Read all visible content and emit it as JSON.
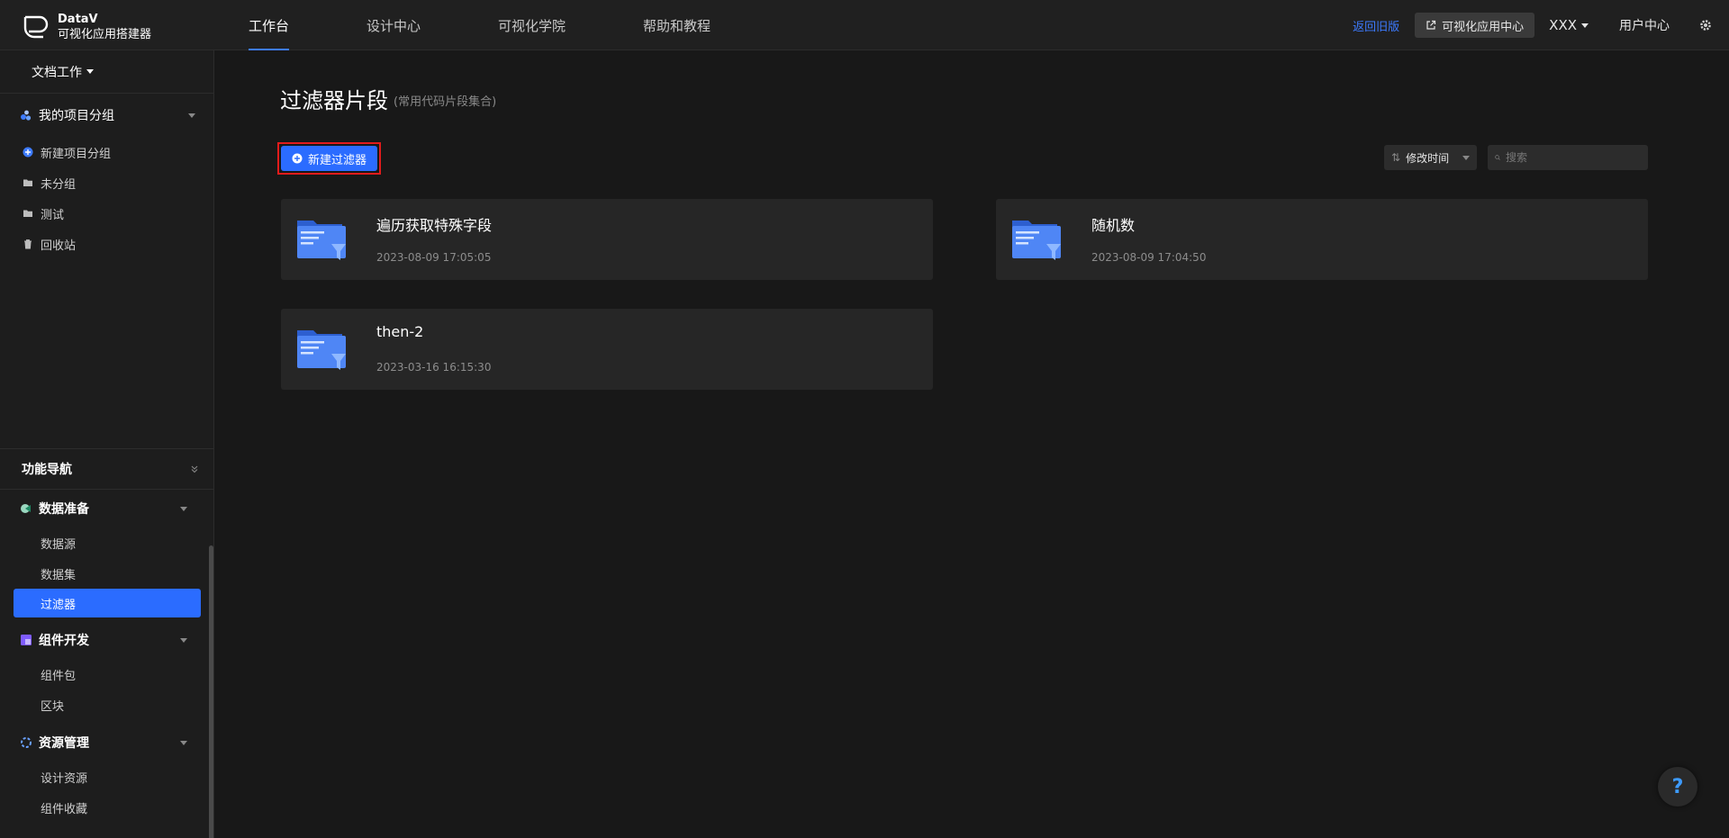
{
  "header": {
    "brand_line1": "DataV",
    "brand_line2": "可视化应用搭建器",
    "nav": [
      {
        "label": "工作台",
        "active": true
      },
      {
        "label": "设计中心"
      },
      {
        "label": "可视化学院"
      },
      {
        "label": "帮助和教程"
      }
    ],
    "back_old": "返回旧版",
    "app_center": "可视化应用中心",
    "user_name": "XXX",
    "user_center": "用户中心",
    "accent": "#3d7bff"
  },
  "sidebar": {
    "workspace": "文档工作",
    "my_groups": "我的项目分组",
    "items": [
      {
        "label": "新建项目分组",
        "icon": "plus-circle-icon"
      },
      {
        "label": "未分组",
        "icon": "folder-icon"
      },
      {
        "label": "测试",
        "icon": "folder-icon"
      },
      {
        "label": "回收站",
        "icon": "trash-icon"
      }
    ],
    "func_nav": "功能导航",
    "sections": [
      {
        "label": "数据准备",
        "icon": "data-prep-icon",
        "children": [
          "数据源",
          "数据集",
          "过滤器"
        ]
      },
      {
        "label": "组件开发",
        "icon": "component-dev-icon",
        "children": [
          "组件包",
          "区块"
        ]
      },
      {
        "label": "资源管理",
        "icon": "resource-icon",
        "children": [
          "设计资源",
          "组件收藏"
        ]
      }
    ],
    "active_item": "过滤器"
  },
  "main": {
    "title": "过滤器片段",
    "subtitle": "(常用代码片段集合)",
    "new_button": "新建过滤器",
    "sort_label": "修改时间",
    "search_placeholder": "搜索",
    "cards": [
      {
        "name": "遍历获取特殊字段",
        "time": "2023-08-09 17:05:05"
      },
      {
        "name": "随机数",
        "time": "2023-08-09 17:04:50"
      },
      {
        "name": "then-2",
        "time": "2023-03-16 16:15:30"
      }
    ],
    "help": "?"
  }
}
